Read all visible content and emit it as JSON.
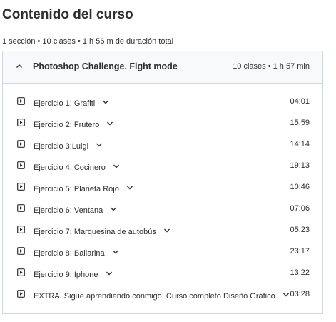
{
  "page": {
    "title": "Contenido del curso",
    "summary": "1 sección • 10 clases • 1 h 56 m de duración total"
  },
  "section": {
    "title": "Photoshop Challenge. Fight mode",
    "meta": "10 clases • 1 h 57 min",
    "expanded": true,
    "lectures": [
      {
        "title": "Ejercicio 1: Grafiti",
        "duration": "04:01",
        "icon": "play-icon"
      },
      {
        "title": "Ejercicio 2: Frutero",
        "duration": "15:59",
        "icon": "play-icon"
      },
      {
        "title": "Ejercicio 3:Luigi",
        "duration": "14:14",
        "icon": "play-icon"
      },
      {
        "title": "Ejercicio 4: Cocinero",
        "duration": "19:13",
        "icon": "play-icon"
      },
      {
        "title": "Ejercicio 5: Planeta Rojo",
        "duration": "10:46",
        "icon": "play-icon"
      },
      {
        "title": "Ejercicio 6: Ventana",
        "duration": "07:06",
        "icon": "play-icon"
      },
      {
        "title": "Ejercicio 7: Marquesina de autobús",
        "duration": "05:23",
        "icon": "play-icon"
      },
      {
        "title": "Ejercicio 8: Bailarina",
        "duration": "23:17",
        "icon": "play-icon"
      },
      {
        "title": "Ejercicio 9: Iphone",
        "duration": "13:22",
        "icon": "play-icon"
      },
      {
        "title": "EXTRA. Sigue aprendiendo conmigo. Curso completo Diseño Gráfico",
        "duration": "03:28",
        "icon": "play-icon"
      }
    ]
  },
  "colors": {
    "text": "#2d2f31",
    "border": "#d1d7dc",
    "header_bg": "#f7f9fa"
  }
}
